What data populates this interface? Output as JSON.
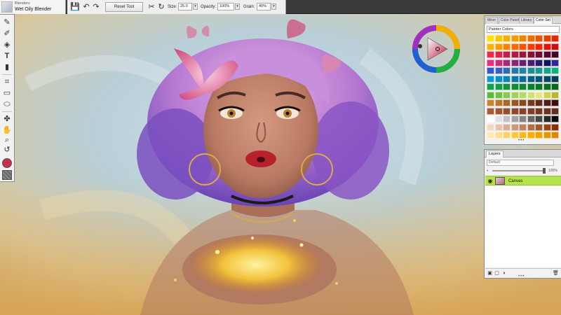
{
  "brush": {
    "category": "Blenders",
    "variant": "Wet Oily Blender"
  },
  "property_bar": {
    "reset_tool_label": "Reset Tool",
    "size_label": "Size:",
    "size_value": "25.0",
    "opacity_label": "Opacity:",
    "opacity_value": "100%",
    "grain_label": "Grain:",
    "grain_value": "40%"
  },
  "toolbox": {
    "tools": [
      "brush-tool",
      "dropper-tool",
      "paint-bucket-tool",
      "text-tool",
      "eraser-tool",
      "crop-tool",
      "rectangle-select-tool",
      "lasso-tool",
      "transform-tool",
      "grabber-tool",
      "magnifier-tool",
      "zoom-tool",
      "rotate-tool"
    ],
    "main_color": "#c8304a"
  },
  "swatch_panel": {
    "tabs": [
      "Mixer",
      "Color Palette",
      "Library",
      "Color Set"
    ],
    "active_tab": "Color Set",
    "library_name": "Painter Colors",
    "swatches": [
      [
        "#f9e100",
        "#f7c600",
        "#f5b000",
        "#f29a00",
        "#f08300",
        "#ee6c00",
        "#ec5500",
        "#e93e00",
        "#e52700"
      ],
      [
        "#ffb200",
        "#ff9a00",
        "#ff8200",
        "#ff6a00",
        "#ff5200",
        "#ff3a00",
        "#ff2200",
        "#e8120f",
        "#cc0d0d"
      ],
      [
        "#ee2a4f",
        "#d9254a",
        "#c32045",
        "#ae1b40",
        "#98163b",
        "#831136",
        "#6e0c31",
        "#59072c",
        "#440227"
      ],
      [
        "#e3317e",
        "#c42d7b",
        "#a52978",
        "#862575",
        "#672172",
        "#481d6f",
        "#29196c",
        "#0a1569",
        "#2f2890"
      ],
      [
        "#3a56c0",
        "#3561b8",
        "#306cb0",
        "#2b77a8",
        "#2682a0",
        "#218d98",
        "#1c9890",
        "#17a388",
        "#12ae80"
      ],
      [
        "#0a9bd6",
        "#0a8fc6",
        "#0a83b6",
        "#0a77a6",
        "#0a6b96",
        "#0a5f86",
        "#0a5376",
        "#0a4766",
        "#0a3b56"
      ],
      [
        "#14a14a",
        "#139a44",
        "#12933e",
        "#118c38",
        "#108532",
        "#0f7e2c",
        "#0e7726",
        "#0d7020",
        "#0c691a"
      ],
      [
        "#5bb83a",
        "#72c046",
        "#89c852",
        "#a0d05e",
        "#b7d86a",
        "#cee076",
        "#e5e882",
        "#d1d24e",
        "#b7b832"
      ],
      [
        "#c98630",
        "#b8772c",
        "#a76828",
        "#965924",
        "#854a20",
        "#743b1c",
        "#632c18",
        "#521d14",
        "#410e10"
      ],
      [
        "#a35c3a",
        "#9b5636",
        "#935032",
        "#8b4a2e",
        "#83442a",
        "#7b3e26",
        "#733822",
        "#6b321e",
        "#632c1a"
      ],
      [
        "#ffffff",
        "#e0e0e0",
        "#c2c2c2",
        "#a3a3a3",
        "#858585",
        "#666666",
        "#474747",
        "#292929",
        "#0a0a0a"
      ],
      [
        "#f1d7c5",
        "#e4c2ac",
        "#d7ad93",
        "#ca987a",
        "#bd8361",
        "#b06e48",
        "#a3592f",
        "#964416",
        "#892f00"
      ],
      [
        "#ffe9b0",
        "#ffdd8a",
        "#ffd164",
        "#ffc53e",
        "#ffb918",
        "#ffad00",
        "#f2a100",
        "#e59500",
        "#d88900"
      ]
    ]
  },
  "layers_panel": {
    "tab_label": "Layers",
    "composite_method": "Default",
    "opacity_text": "100%",
    "layer_name": "Canvas"
  }
}
